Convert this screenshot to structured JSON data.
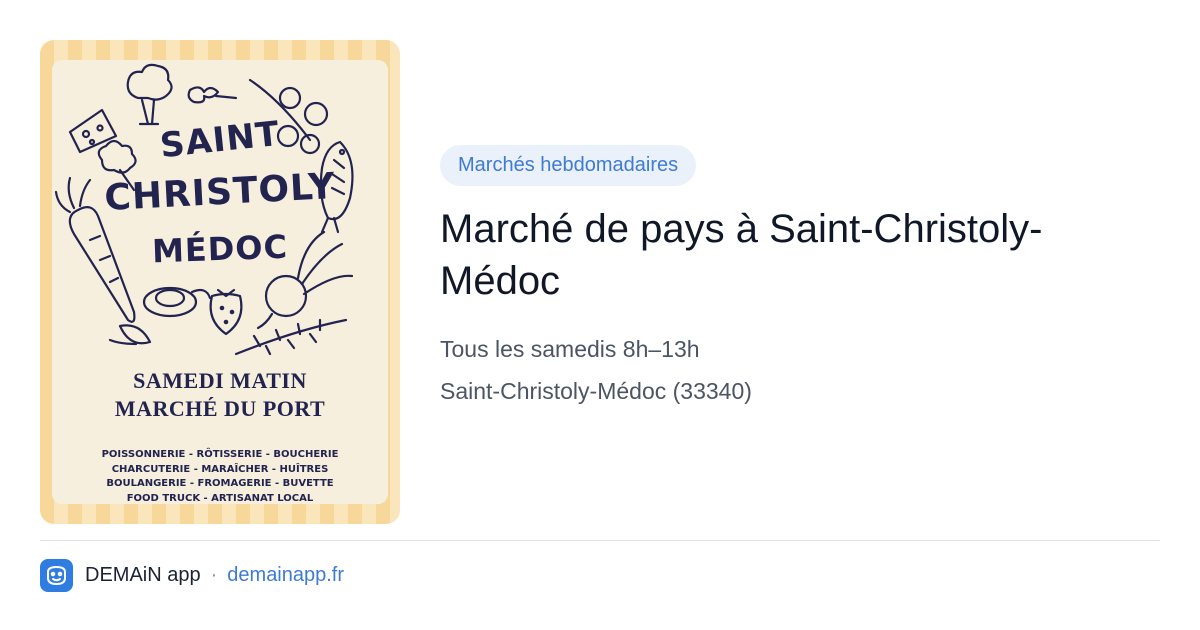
{
  "poster": {
    "title_line1": "SAINT",
    "title_line2": "CHRISTOLY",
    "title_line3": "MÉDOC",
    "subtitle_line1": "SAMEDI MATIN",
    "subtitle_line2": "MARCHÉ DU PORT",
    "list_line1": "POISSONNERIE - RÔTISSERIE - BOUCHERIE",
    "list_line2": "CHARCUTERIE - MARAÎCHER - HUÎTRES",
    "list_line3": "BOULANGERIE - FROMAGERIE - BUVETTE",
    "list_line4": "FOOD TRUCK - ARTISANAT LOCAL",
    "colors": {
      "stripe_a": "#f7d79a",
      "stripe_b": "#fbe6bb",
      "paper": "#f6efde",
      "ink": "#23234f"
    }
  },
  "event": {
    "category": "Marchés hebdomadaires",
    "title": "Marché de pays à Saint-Christoly-Médoc",
    "schedule": "Tous les samedis 8h–13h",
    "location": "Saint-Christoly-Médoc (33340)"
  },
  "footer": {
    "app_icon": "demain-app-icon",
    "app_name": "DEMAiN app",
    "separator": "·",
    "link": "demainapp.fr"
  },
  "colors": {
    "accent": "#3e7bd1",
    "badge_bg": "#eaf1fb",
    "divider": "#dde3ea"
  }
}
